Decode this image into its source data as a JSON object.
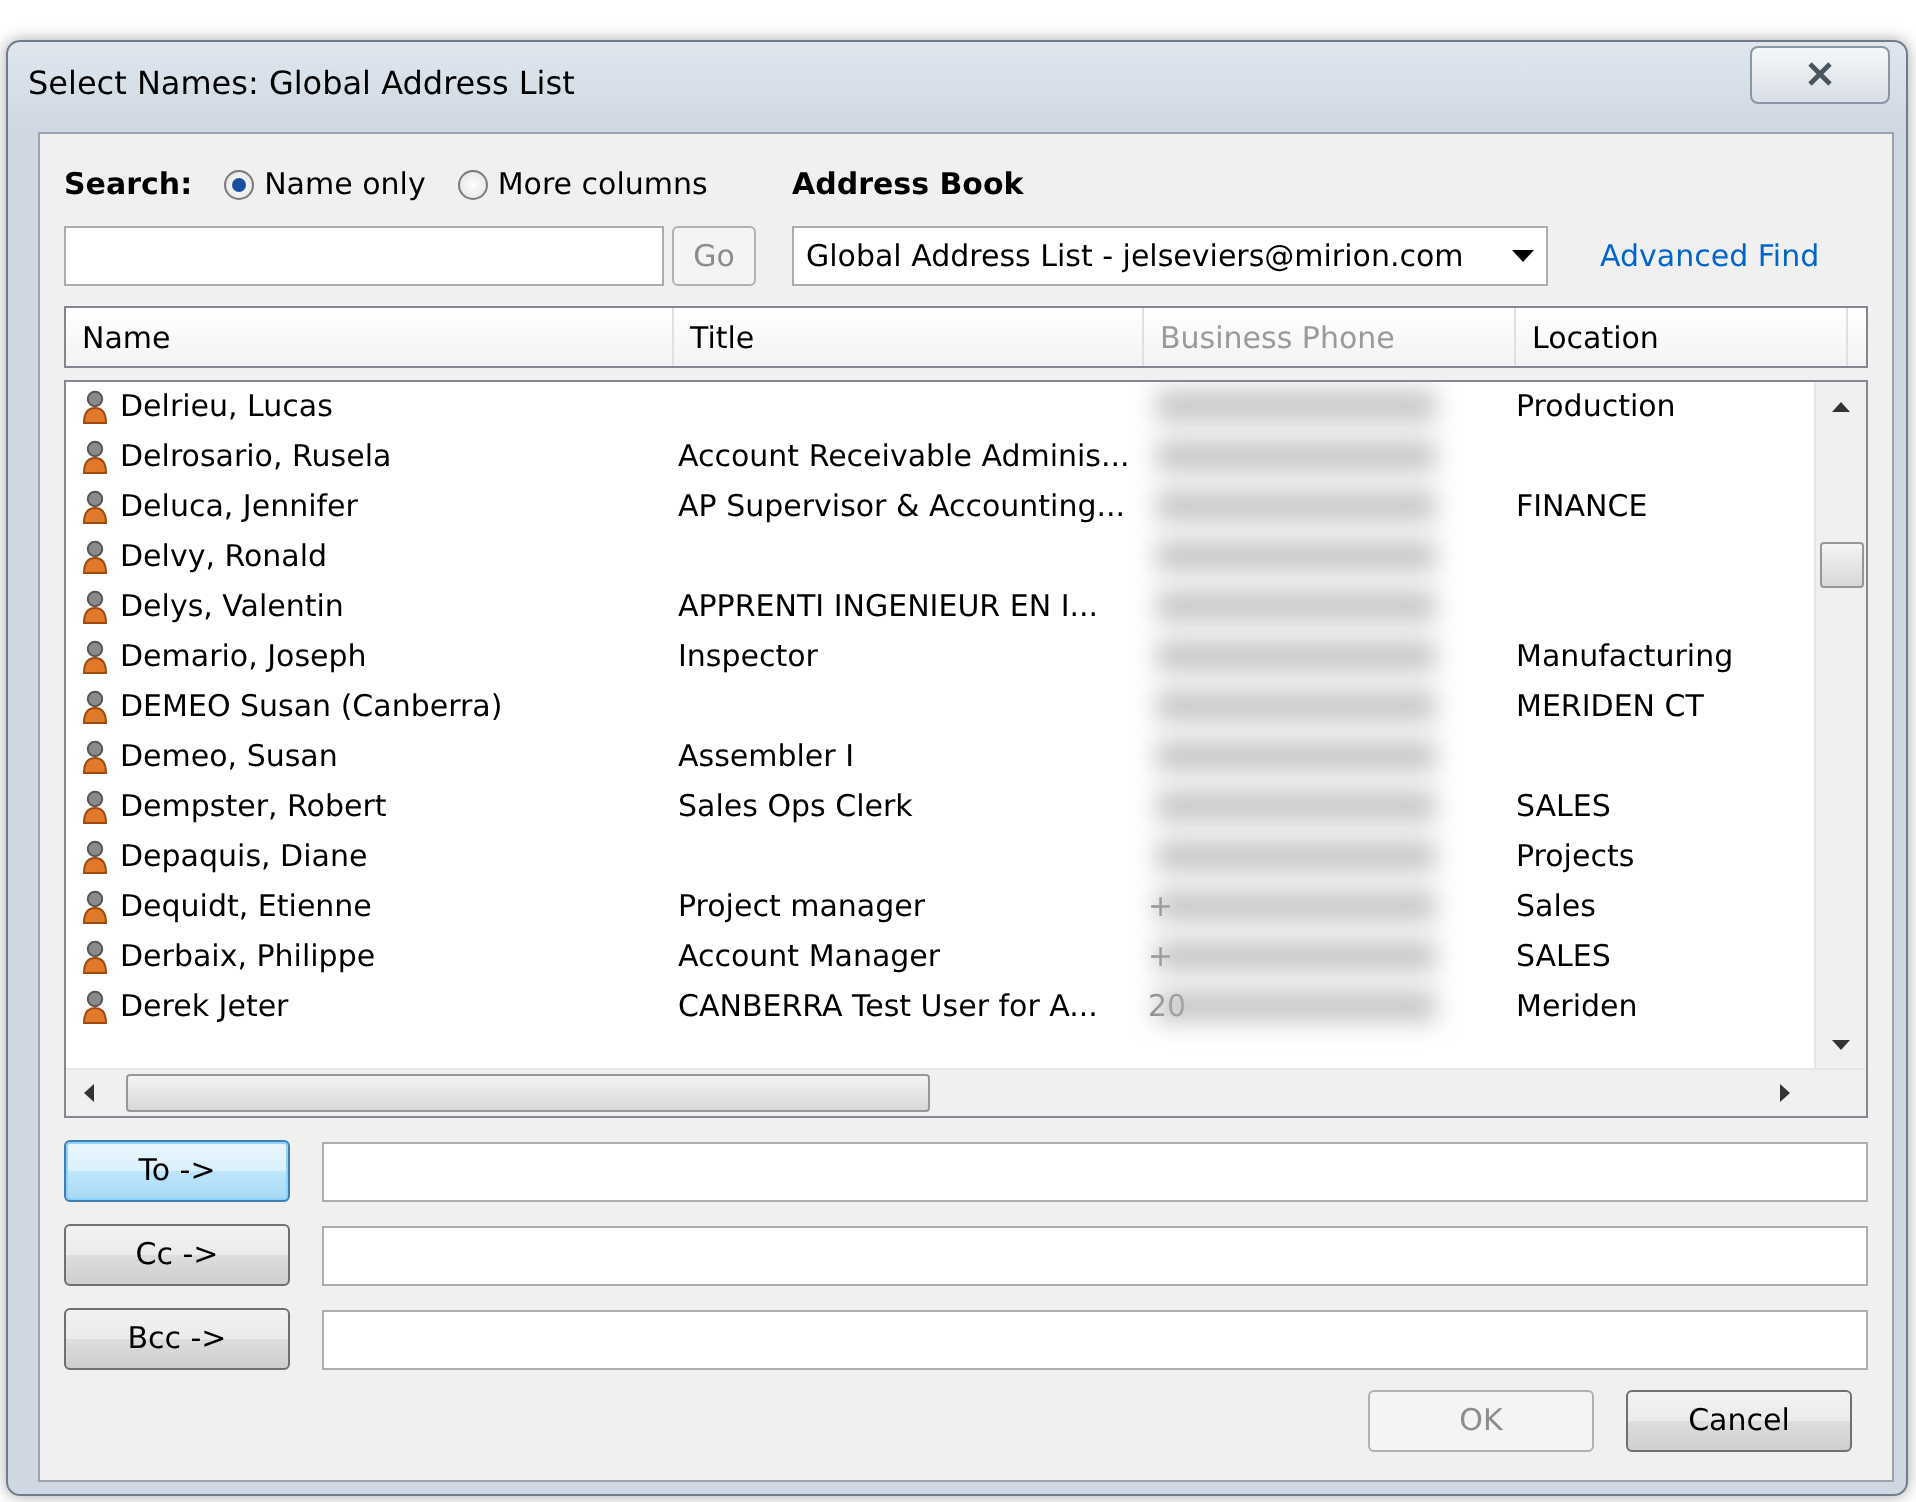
{
  "window": {
    "title": "Select Names: Global Address List"
  },
  "search": {
    "label": "Search:",
    "options": [
      {
        "label": "Name only",
        "selected": true
      },
      {
        "label": "More columns",
        "selected": false
      }
    ],
    "go_button": {
      "label": "Go",
      "disabled": true
    }
  },
  "address_book": {
    "label": "Address Book",
    "value": "Global Address List - jelseviers@mirion.com"
  },
  "advanced_find": "Advanced Find",
  "table": {
    "columns": [
      {
        "label": "Name",
        "dimmed": false
      },
      {
        "label": "Title",
        "dimmed": false
      },
      {
        "label": "Business Phone",
        "dimmed": true
      },
      {
        "label": "Location",
        "dimmed": false
      }
    ],
    "rows": [
      {
        "name": "Delrieu, Lucas",
        "location": "Production"
      },
      {
        "name": "Delrosario, Rusela",
        "title": "Account Receivable Adminis..."
      },
      {
        "name": "Deluca, Jennifer",
        "title": "AP Supervisor & Accounting...",
        "location": "FINANCE"
      },
      {
        "name": "Delvy, Ronald"
      },
      {
        "name": "Delys, Valentin",
        "title": "APPRENTI INGENIEUR EN I..."
      },
      {
        "name": "Demario, Joseph",
        "title": "Inspector",
        "location": "Manufacturing"
      },
      {
        "name": "DEMEO Susan (Canberra)",
        "location": "MERIDEN CT"
      },
      {
        "name": "Demeo, Susan",
        "title": "Assembler I"
      },
      {
        "name": "Dempster, Robert",
        "title": "Sales Ops Clerk",
        "location": "SALES"
      },
      {
        "name": "Depaquis, Diane",
        "location": "Projects"
      },
      {
        "name": "Dequidt, Etienne",
        "title": "Project manager",
        "phone": "+",
        "location": "Sales"
      },
      {
        "name": "Derbaix, Philippe",
        "title": "Account Manager",
        "phone": "+",
        "location": "SALES"
      },
      {
        "name": "Derek Jeter",
        "title": "CANBERRA Test User for A...",
        "phone": "20",
        "location": "Meriden"
      }
    ]
  },
  "recipients": [
    {
      "label": "To ->",
      "focused": true
    },
    {
      "label": "Cc ->",
      "focused": false
    },
    {
      "label": "Bcc ->",
      "focused": false
    }
  ],
  "buttons": [
    {
      "label": "OK",
      "disabled": true
    },
    {
      "label": "Cancel",
      "disabled": false
    }
  ]
}
